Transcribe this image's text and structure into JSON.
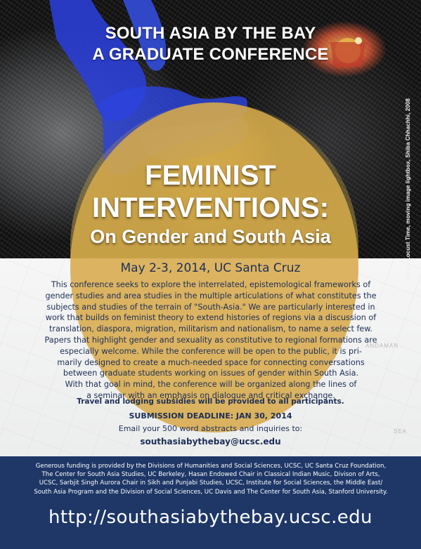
{
  "header": {
    "line1": "SOUTH ASIA BY THE BAY",
    "line2": "A GRADUATE CONFERENCE"
  },
  "image_credit": "Image: Locust Time, moving image lightbox, Shiba Chhachhi, 2008",
  "title": {
    "line1": "FEMINIST",
    "line2": "INTERVENTIONS:",
    "subtitle": "On Gender and South Asia"
  },
  "event": {
    "dates": "May 2-3, 2014, UC Santa Cruz"
  },
  "description": {
    "lines": [
      "This conference seeks to explore the interrelated, epistemological frameworks of",
      "gender studies and area studies in the multiple articulations of what constitutes the",
      "subjects and studies of the terrain of \"South-Asia.\"  We are particularly interested in",
      "work that builds on feminist theory to extend histories of regions via a discussion of",
      "translation, diaspora, migration, militarism and nationalism, to name a select few.",
      "Papers that highlight gender and sexuality as constitutive to regional formations are",
      "especially welcome. While the conference will be open to the public, it is pri-",
      "marily designed to create a much-needed space for connecting conversations",
      "between graduate students working on issues of gender within South Asia.",
      "With that goal in mind, the conference will be organized along the lines of",
      "a seminar with an emphasis on dialogue and critical exchange."
    ]
  },
  "subsidy": "Travel and lodging subsidies will be provided to all participants.",
  "deadline": "SUBMISSION DEADLINE: JAN 30, 2014",
  "contact": {
    "prompt": "Email your 500 word abstracts and inquiries to:",
    "email": "southasiabythebay@ucsc.edu"
  },
  "map_labels": {
    "sea": "SEA",
    "islands": "ANDAMAN"
  },
  "footer": {
    "funding_lines": [
      "Generous funding is provided by the Divisions of Humanities and Social Sciences, UCSC, UC Santa Cruz Foundation,",
      "The Center for South Asia Studies, UC Berkeley, Hasan Endowed Chair in Classical Indian Music, Divison of Arts,",
      "UCSC, Sarbjit Singh Aurora Chair in Sikh and Punjabi Studies, UCSC, Institute for Social Sciences, the Middle East/",
      "South Asia Program and the Division of Social Sciences, UC Davis and The Center for South Asia, Stanford University."
    ],
    "url": "http://southasiabythebay.ucsc.edu"
  },
  "colors": {
    "navy": "#1e3767",
    "text_navy": "#1d2f56",
    "gold": "#d7aa4c",
    "figure_blue": "#2a3fd8"
  }
}
